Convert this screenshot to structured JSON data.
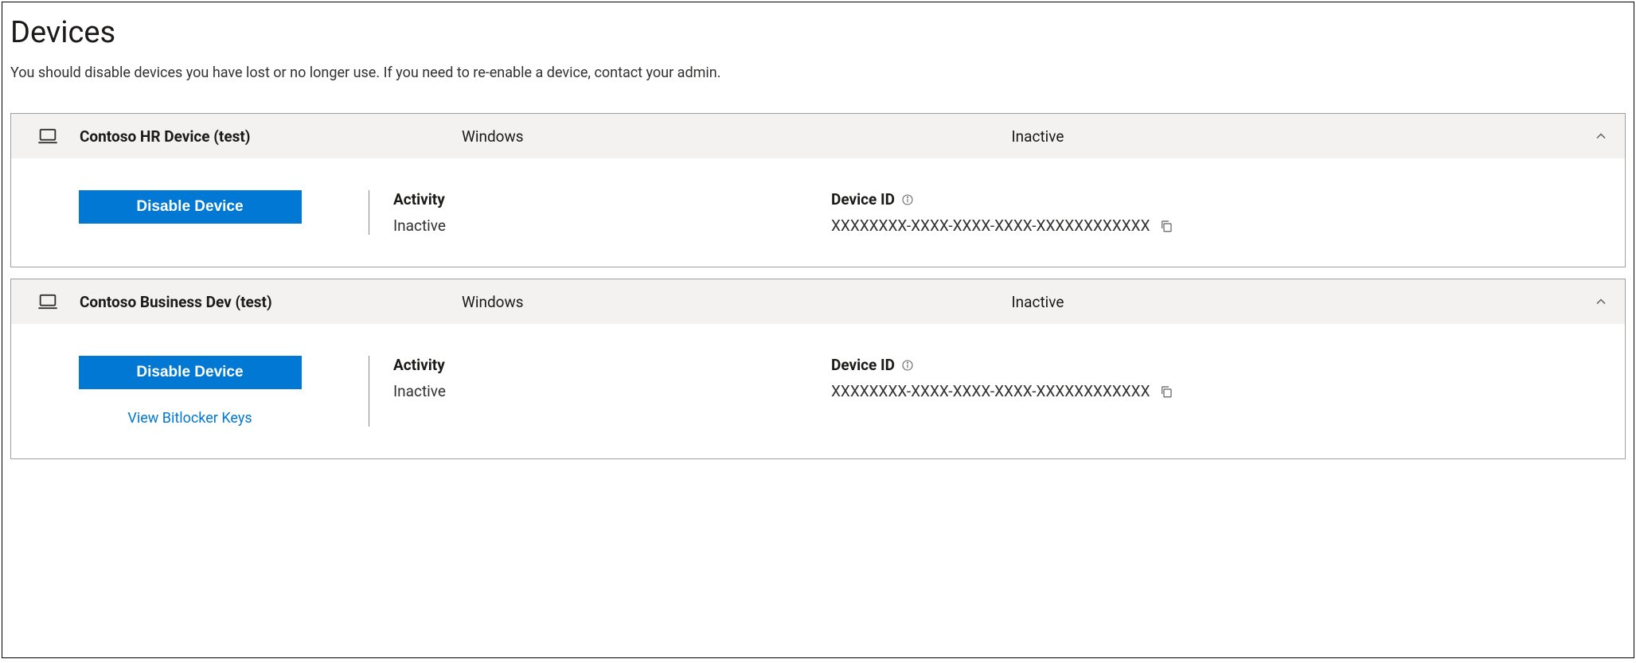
{
  "page": {
    "title": "Devices",
    "subtitle": "You should disable devices you have lost or no longer use. If you need to re-enable a device, contact your admin."
  },
  "labels": {
    "activity": "Activity",
    "device_id": "Device ID",
    "disable": "Disable Device",
    "view_bitlocker": "View Bitlocker Keys"
  },
  "devices": [
    {
      "name": "Contoso HR Device (test)",
      "os": "Windows",
      "status": "Inactive",
      "activity": "Inactive",
      "device_id": "XXXXXXXX-XXXX-XXXX-XXXX-XXXXXXXXXXXX",
      "has_bitlocker": false
    },
    {
      "name": "Contoso Business Dev (test)",
      "os": "Windows",
      "status": "Inactive",
      "activity": "Inactive",
      "device_id": "XXXXXXXX-XXXX-XXXX-XXXX-XXXXXXXXXXXX",
      "has_bitlocker": true
    }
  ]
}
